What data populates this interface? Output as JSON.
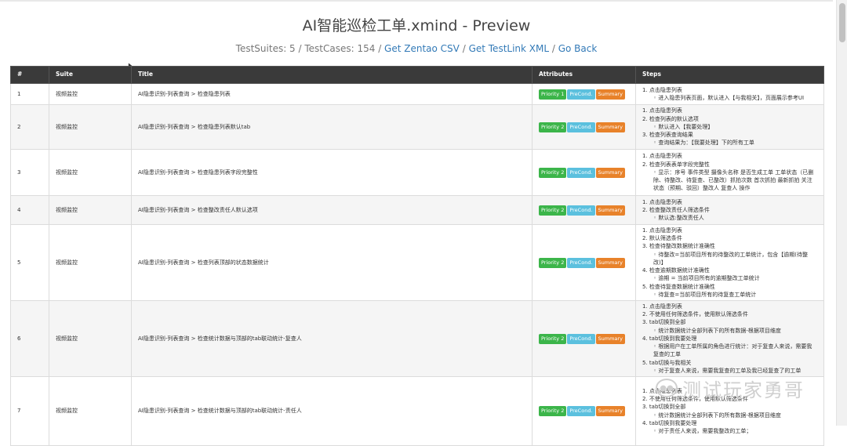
{
  "page": {
    "title": "AI智能巡检工单.xmind - Preview",
    "stats": "TestSuites: 5 / TestCases: 154 / ",
    "links": [
      "Get Zentao CSV",
      "Get TestLink XML",
      "Go Back"
    ],
    "separator": " / "
  },
  "table": {
    "headers": [
      "#",
      "Suite",
      "Title",
      "Attributes",
      "Steps"
    ],
    "rows": [
      {
        "num": "1",
        "suite": "视频监控",
        "title": "AI隐患识别-列表查询 > 检查隐患列表",
        "priority": "Priority 1",
        "precond": "PreCond.",
        "summary": "Summary",
        "steps": [
          {
            "text": "1. 点击隐患列表",
            "subs": [
              "进入隐患列表页面，默认进入【与我相关】，页面展示参考UI"
            ]
          }
        ]
      },
      {
        "num": "2",
        "suite": "视频监控",
        "title": "AI隐患识别-列表查询 > 检查隐患列表默认tab",
        "priority": "Priority 2",
        "precond": "PreCond.",
        "summary": "Summary",
        "steps": [
          {
            "text": "1. 点击隐患列表",
            "subs": []
          },
          {
            "text": "2. 检查列表的默认选项",
            "subs": [
              "默认进入【我要处理】"
            ]
          },
          {
            "text": "3. 检查列表查询结果",
            "subs": [
              "查询结果为：【我要处理】下的所有工单"
            ]
          }
        ]
      },
      {
        "num": "3",
        "suite": "视频监控",
        "title": "AI隐患识别-列表查询 > 检查隐患列表字段完整性",
        "priority": "Priority 2",
        "precond": "PreCond.",
        "summary": "Summary",
        "steps": [
          {
            "text": "1. 点击隐患列表",
            "subs": []
          },
          {
            "text": "2. 检查列表表单字段完整性",
            "subs": [
              "显示：序号 事件类型 摄像头名称 是否生成工单 工单状态（已删除、待整改、待复查、已整改）抓拍次数 首次抓拍 最新抓拍 关注状态（预期、驳回）整改人 复查人 操作"
            ]
          }
        ]
      },
      {
        "num": "4",
        "suite": "视频监控",
        "title": "AI隐患识别-列表查询 > 检查整改责任人默认选项",
        "priority": "Priority 2",
        "precond": "PreCond.",
        "summary": "Summary",
        "steps": [
          {
            "text": "1. 点击隐患列表",
            "subs": []
          },
          {
            "text": "2. 检查整改责任人筛选条件",
            "subs": [
              "默认选:整改责任人"
            ]
          }
        ]
      },
      {
        "num": "5",
        "suite": "视频监控",
        "title": "AI隐患识别-列表查询 > 检查列表顶部的状态数据统计",
        "priority": "Priority 2",
        "precond": "PreCond.",
        "summary": "Summary",
        "steps": [
          {
            "text": "1. 点击隐患列表",
            "subs": []
          },
          {
            "text": "2. 默认筛选条件",
            "subs": []
          },
          {
            "text": "3. 检查待整改数据统计准确性",
            "subs": [
              "待整改=当前项目所有的待整改的工单统计，包含【逾期(待整改)】"
            ]
          },
          {
            "text": "4. 检查逾期数据统计准确性",
            "subs": [
              "逾期 = 当前项目所有的逾期整改工单统计"
            ]
          },
          {
            "text": "5. 检查待复查数据统计准确性",
            "subs": [
              "待复查=当前项目所有的待复查工单统计"
            ]
          }
        ]
      },
      {
        "num": "6",
        "suite": "视频监控",
        "title": "AI隐患识别-列表查询 > 检查统计数据与顶部的tab联动统计-复查人",
        "priority": "Priority 2",
        "precond": "PreCond.",
        "summary": "Summary",
        "steps": [
          {
            "text": "1. 点击隐患列表",
            "subs": []
          },
          {
            "text": "2. 不使用任何筛选条件，使用默认筛选条件",
            "subs": []
          },
          {
            "text": "3. tab切换到全部",
            "subs": [
              "统计数据统计全部列表下的所有数据-根据项目维度"
            ]
          },
          {
            "text": "4. tab切换到我要处理",
            "subs": [
              "根据用户在工单所属的角色进行统计：对于复查人来说，需要我复查的工单"
            ]
          },
          {
            "text": "5. tab切换与我相关",
            "subs": [
              "对于复查人来说，需要我复查的工单及我已经复查了的工单"
            ]
          }
        ]
      },
      {
        "num": "7",
        "suite": "视频监控",
        "title": "AI隐患识别-列表查询 > 检查统计数据与顶部的tab联动统计-责任人",
        "priority": "Priority 2",
        "precond": "PreCond.",
        "summary": "Summary",
        "steps": [
          {
            "text": "1. 点击隐患列表",
            "subs": []
          },
          {
            "text": "2. 不使用任何筛选条件，使用默认筛选条件",
            "subs": []
          },
          {
            "text": "3. tab切换到全部",
            "subs": [
              "统计数据统计全部列表下的所有数据-根据项目维度"
            ]
          },
          {
            "text": "4. tab切换到我要处理",
            "subs": [
              "对于责任人来说，需要我整改的工单；"
            ]
          }
        ]
      }
    ]
  },
  "watermark": "测试玩家勇哥"
}
